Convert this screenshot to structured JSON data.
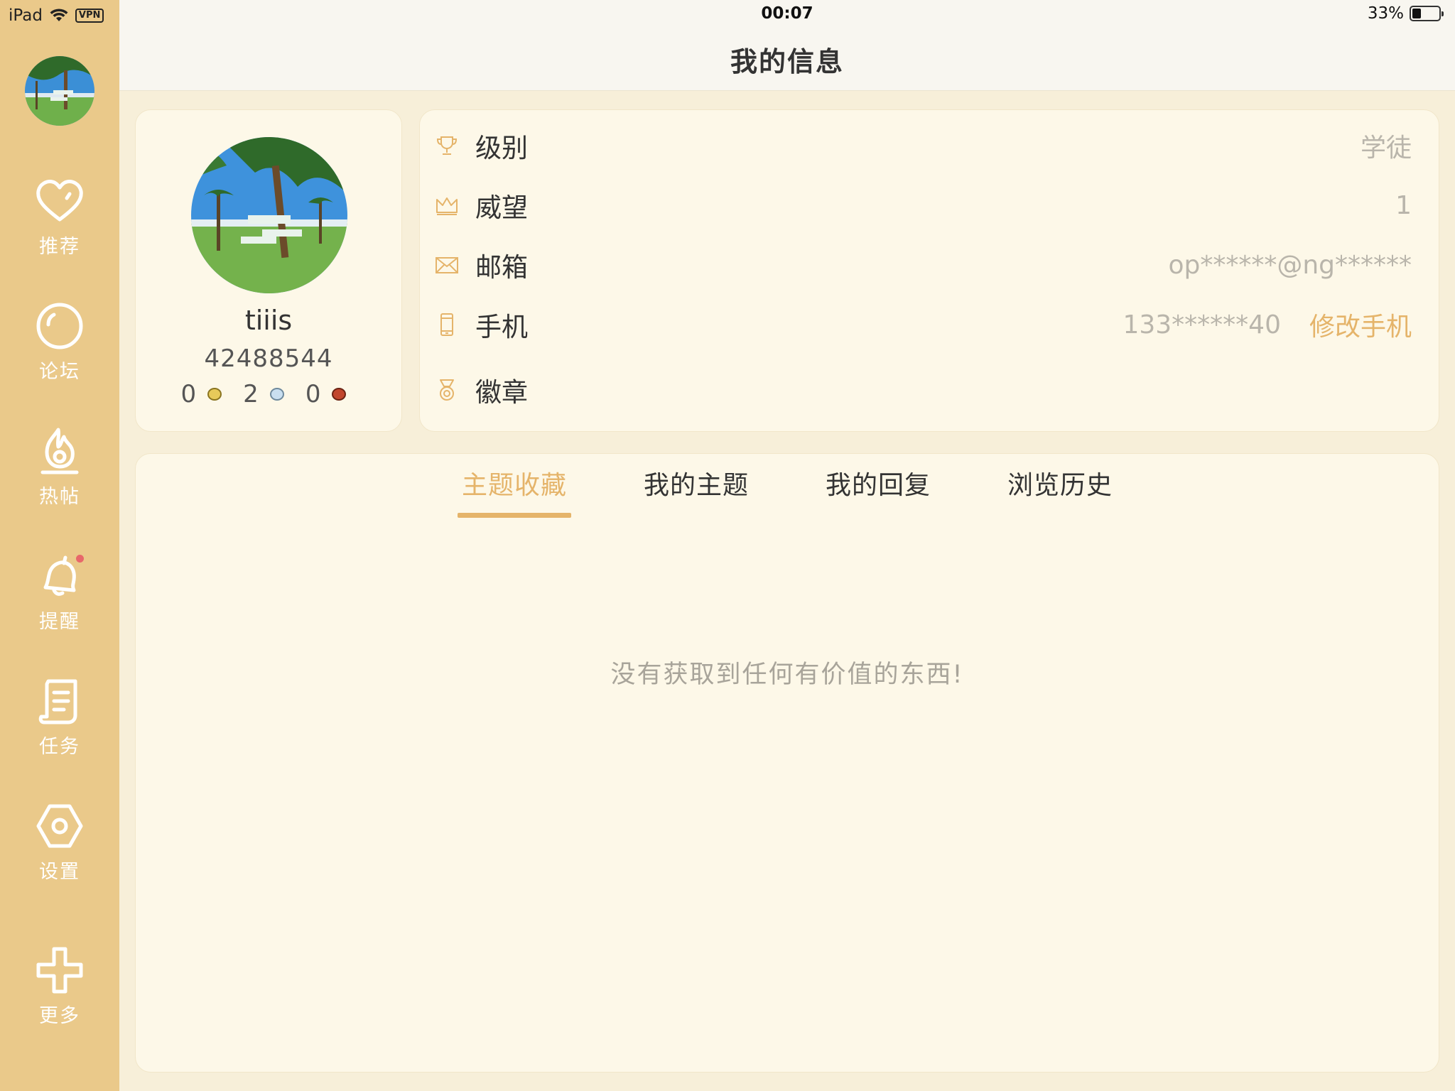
{
  "status_bar": {
    "device": "iPad",
    "vpn": "VPN",
    "time": "00:07",
    "battery": "33%",
    "battery_level": 0.33
  },
  "header": {
    "title": "我的信息"
  },
  "sidebar": {
    "items": [
      {
        "label": "推荐",
        "icon": "heart-icon"
      },
      {
        "label": "论坛",
        "icon": "forum-icon"
      },
      {
        "label": "热帖",
        "icon": "flame-icon"
      },
      {
        "label": "提醒",
        "icon": "bell-icon",
        "has_badge": true
      },
      {
        "label": "任务",
        "icon": "task-scroll-icon"
      },
      {
        "label": "设置",
        "icon": "settings-hex-icon"
      },
      {
        "label": "更多",
        "icon": "plus-icon"
      }
    ]
  },
  "profile": {
    "name": "tiiis",
    "uid": "42488544",
    "coins": {
      "gold": "0",
      "silver": "2",
      "copper": "0"
    }
  },
  "info": {
    "rows": [
      {
        "label": "级别",
        "value": "学徒",
        "icon": "trophy-icon"
      },
      {
        "label": "威望",
        "value": "1",
        "icon": "crown-icon"
      },
      {
        "label": "邮箱",
        "value": "op******@ng******",
        "icon": "mail-icon"
      },
      {
        "label": "手机",
        "value": "133******40",
        "action": "修改手机",
        "icon": "phone-icon"
      },
      {
        "label": "徽章",
        "value": "",
        "icon": "medal-icon"
      }
    ]
  },
  "tabs": [
    {
      "label": "主题收藏",
      "active": true
    },
    {
      "label": "我的主题",
      "active": false
    },
    {
      "label": "我的回复",
      "active": false
    },
    {
      "label": "浏览历史",
      "active": false
    }
  ],
  "empty_message": "没有获取到任何有价值的东西!",
  "colors": {
    "sidebar": "#eac98a",
    "accent": "#e5b46a",
    "card": "#fdf8e8",
    "background": "#f7efd9",
    "badge": "#e8676a"
  }
}
